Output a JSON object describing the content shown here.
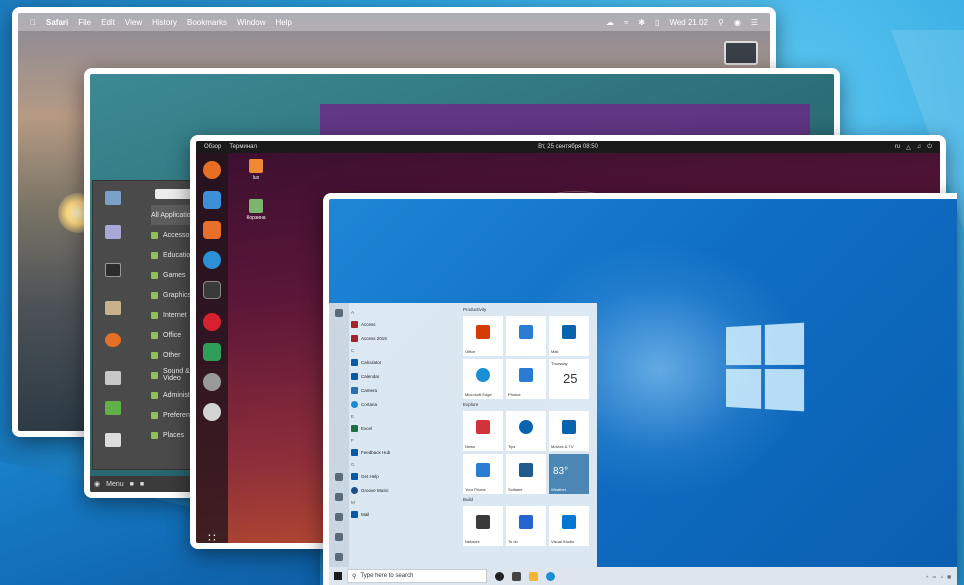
{
  "mac": {
    "menu": [
      "Safari",
      "File",
      "Edit",
      "View",
      "History",
      "Bookmarks",
      "Window",
      "Help"
    ],
    "clock": "Wed 21.02"
  },
  "mint": {
    "all_apps": "All Applications",
    "categories": [
      "Accessories",
      "Education",
      "Games",
      "Graphics",
      "Internet",
      "Office",
      "Other",
      "Sound & Video",
      "Administration",
      "Preferences",
      "Places"
    ],
    "panel_menu": "Menu"
  },
  "ubuntu": {
    "activities": "Обзор",
    "app_menu": "Терминал",
    "clock": "Вт, 25 сентября 08:50",
    "lang": "ru",
    "desktop_icons": [
      "lux",
      "Корзина"
    ]
  },
  "win10": {
    "search_placeholder": "Type here to search",
    "sections": [
      "Productivity",
      "Explore",
      "Build"
    ],
    "calendar_day": "Thursday",
    "calendar_date": "25",
    "weather_temp": "83°",
    "app_list": [
      "A",
      "Access",
      "Access 2019",
      "C",
      "Calculator",
      "Calendar",
      "Camera",
      "Cortana",
      "E",
      "Excel",
      "F",
      "Feedback Hub",
      "G",
      "Get Help",
      "Groove Music",
      "M",
      "Mail"
    ],
    "tile_labels": [
      "Office",
      "",
      "Mail",
      "Microsoft Edge",
      "Photos",
      "",
      "News",
      "Tips",
      "Movies & TV",
      "Your Phone",
      "Solitaire",
      "Weather",
      "Network",
      "To do",
      "Visual Studio"
    ]
  },
  "colors": {
    "win_blue": "#0f6ec4",
    "mint_green": "#8fc05a",
    "ubuntu_orange": "#e95420"
  }
}
